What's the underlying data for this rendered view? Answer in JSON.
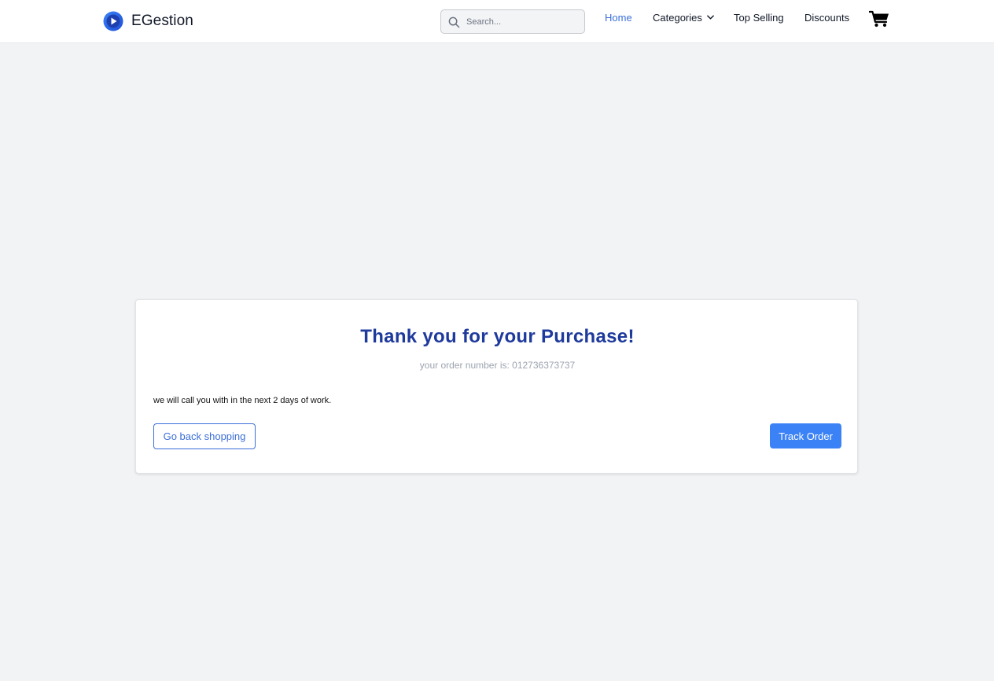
{
  "header": {
    "brand_name": "EGestion",
    "logo_icon": "play-circle-icon",
    "search": {
      "placeholder": "Search...",
      "value": ""
    },
    "nav": {
      "home": "Home",
      "categories": "Categories",
      "top_selling": "Top Selling",
      "discounts": "Discounts"
    },
    "cart_icon": "cart-icon",
    "active_nav": "Home"
  },
  "confirmation": {
    "title": "Thank you for your Purchase!",
    "order_number_text": "your order number is: 012736373737",
    "message": "we will call you with in the next 2 days of work.",
    "back_button": "Go back shopping",
    "track_button": "Track Order"
  },
  "colors": {
    "accent": "#3b82f6",
    "title": "#1e3a9c",
    "page_background": "#f2f3f5"
  }
}
